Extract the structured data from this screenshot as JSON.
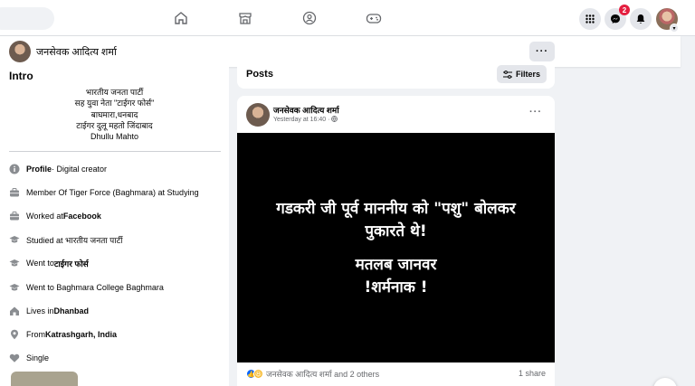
{
  "nav": {
    "icons": [
      "home-icon",
      "marketplace-icon",
      "groups-icon",
      "gaming-icon"
    ],
    "right_icons": [
      "menu-grid-icon",
      "messenger-icon",
      "notifications-icon"
    ],
    "messenger_badge": "2"
  },
  "subheader": {
    "name": "जनसेवक आदित्य शर्मा",
    "more": "···"
  },
  "intro": {
    "title": "Intro",
    "bio": [
      "भारतीय जनता पार्टी",
      "सह युवा नेता \"टाईगर फोर्स\"",
      "बाघमारा,धनबाद",
      "टाईगर दुलू महतो जिंदाबाद",
      "Dhullu Mahto"
    ],
    "rows": [
      {
        "icon": "info-icon",
        "pre": "",
        "bold": "Profile",
        "post": " · Digital creator"
      },
      {
        "icon": "work-icon",
        "pre": "Member Of Tiger Force (Baghmara) at Studying",
        "bold": "",
        "post": ""
      },
      {
        "icon": "work-icon",
        "pre": "Worked at ",
        "bold": "Facebook",
        "post": ""
      },
      {
        "icon": "education-icon",
        "pre": "Studied at भारतीय जनता पार्टी",
        "bold": "",
        "post": ""
      },
      {
        "icon": "education-icon",
        "pre": "Went to ",
        "bold": "टाईगर फोर्स",
        "post": ""
      },
      {
        "icon": "education-icon",
        "pre": "Went to Baghmara College Baghmara",
        "bold": "",
        "post": ""
      },
      {
        "icon": "home-icon",
        "pre": "Lives in ",
        "bold": "Dhanbad",
        "post": ""
      },
      {
        "icon": "location-icon",
        "pre": "From ",
        "bold": "Katrashgarh, India",
        "post": ""
      },
      {
        "icon": "heart-icon",
        "pre": "Single",
        "bold": "",
        "post": ""
      }
    ]
  },
  "posts": {
    "title": "Posts",
    "filters": "Filters"
  },
  "post": {
    "author": "जनसेवक आदित्य शर्मा",
    "time": "Yesterday at 16:40 ·",
    "more": "···",
    "image_lines": [
      "गडकरी जी पूर्व माननीय को \"पशु\" बोलकर",
      "पुकारते थे!",
      "मतलब जानवर",
      "!शर्मनाक !"
    ],
    "reactions_text": "जनसेवक आदित्य शर्मा and 2 others",
    "shares": "1 share"
  },
  "colors": {
    "accent": "#0866ff",
    "badge": "#e41e3f"
  }
}
